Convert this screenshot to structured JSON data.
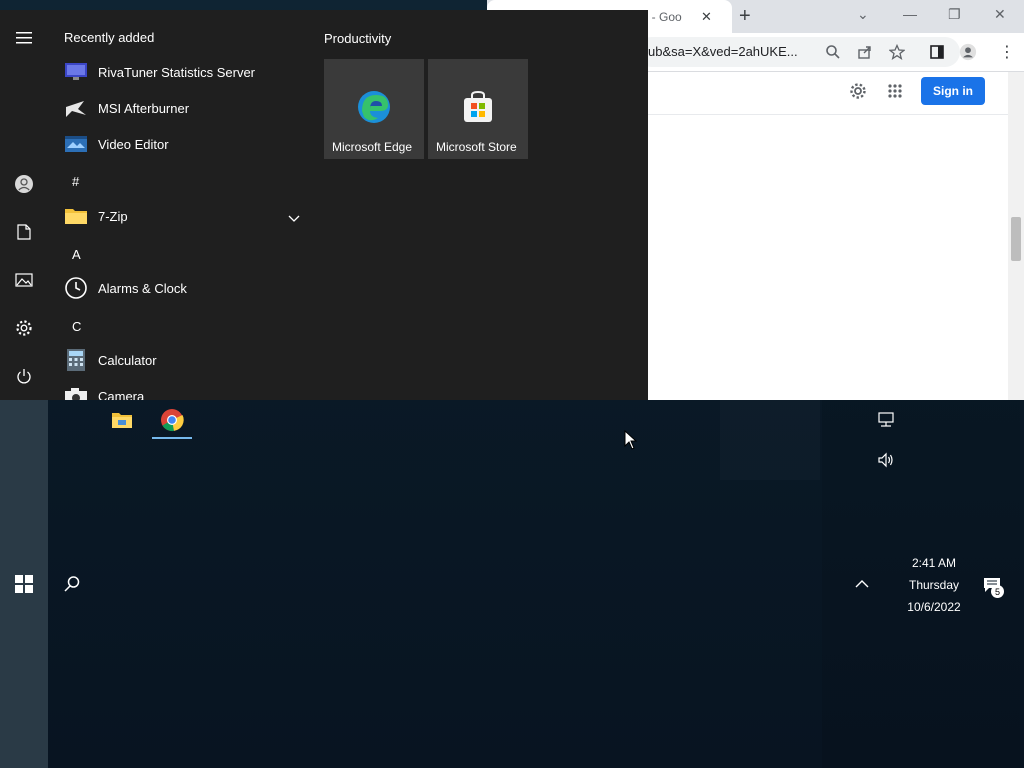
{
  "browser": {
    "tab_title": "ub - Goo",
    "url": "ub&sa=X&ved=2ahUKE...",
    "signin_label": "Sign in",
    "tab_close_glyph": "✕",
    "new_tab_glyph": "+",
    "minimize_glyph": "—",
    "restore_glyph": "❐",
    "close_glyph": "✕",
    "tabsearch_glyph": "⌄",
    "menu_glyph": "⋮"
  },
  "start_menu": {
    "recently_added_header": "Recently added",
    "recent_apps": [
      {
        "label": "RivaTuner Statistics Server",
        "icon": "rivatuner-icon"
      },
      {
        "label": "MSI Afterburner",
        "icon": "afterburner-icon"
      },
      {
        "label": "Video Editor",
        "icon": "video-editor-icon"
      }
    ],
    "sections": [
      {
        "letter": "#",
        "apps": [
          {
            "label": "7-Zip",
            "icon": "folder-icon"
          }
        ]
      },
      {
        "letter": "A",
        "apps": [
          {
            "label": "Alarms & Clock",
            "icon": "clock-icon"
          }
        ]
      },
      {
        "letter": "C",
        "apps": [
          {
            "label": "Calculator",
            "icon": "calculator-icon"
          },
          {
            "label": "Camera",
            "icon": "camera-icon"
          }
        ]
      }
    ],
    "tiles_group": "Productivity",
    "tiles": [
      {
        "label": "Microsoft Edge",
        "icon": "edge-icon"
      },
      {
        "label": "Microsoft Store",
        "icon": "store-icon"
      }
    ]
  },
  "taskbar": {
    "clock_time": "2:41 AM",
    "clock_day": "Thursday",
    "clock_date": "10/6/2022",
    "notification_count": "5",
    "accent_color": "#76b9ed"
  }
}
